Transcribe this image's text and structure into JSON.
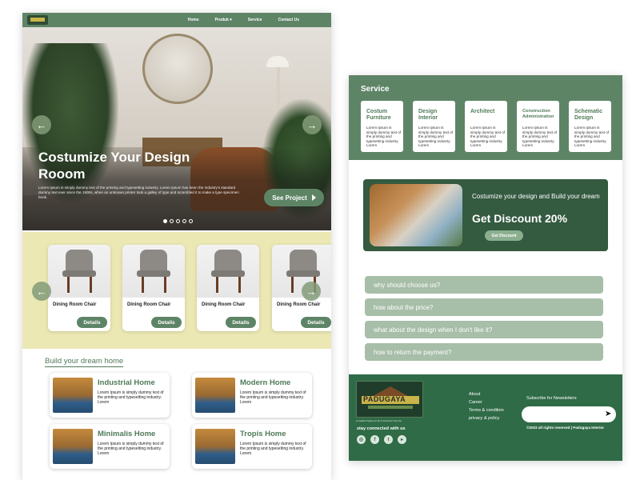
{
  "left_page": {
    "nav": {
      "links": [
        "Home",
        "Produk ▾",
        "Service",
        "Contact Us"
      ]
    },
    "hero": {
      "title": "Costumize Your Design Rooom",
      "description": "Lorem Ipsum is simply dummy text of the printing and typesetting industry. Lorem Ipsum has been the industry's standard dummy text ever since the 1500s, when an unknown printer took a galley of type and scrambled it to make a type specimen book.",
      "cta_label": "See Project",
      "slide_count": 5,
      "active_slide": 1
    },
    "products": {
      "items": [
        {
          "name": "Dining Room Chair",
          "button": "Details"
        },
        {
          "name": "Dining Room Chair",
          "button": "Details"
        },
        {
          "name": "Dining Room Chair",
          "button": "Details"
        },
        {
          "name": "Dining Room Chair",
          "button": "Details"
        }
      ]
    },
    "build": {
      "heading": "Build your dream home",
      "cards": [
        {
          "title": "Industrial Home",
          "text": "Lorem Ipsum is simply dummy text of the printing and typesetting industry. Lorem"
        },
        {
          "title": "Modern Home",
          "text": "Lorem Ipsum is simply dummy text of the printing and typesetting industry. Lorem"
        },
        {
          "title": "Minimalis Home",
          "text": "Lorem Ipsum is simply dummy text of the printing and typesetting industry. Lorem"
        },
        {
          "title": "Tropis Home",
          "text": "Lorem Ipsum is simply dummy text of the printing and typesetting industry. Lorem"
        }
      ]
    }
  },
  "right_page": {
    "service": {
      "title": "Service",
      "cards": [
        {
          "name": "Costum Furniture",
          "text": "Lorem Ipsum is simply dummy text of the printing and typesetting industry. Lorem"
        },
        {
          "name": "Design Interior",
          "text": "Lorem Ipsum is simply dummy text of the printing and typesetting industry. Lorem"
        },
        {
          "name": "Architect",
          "text": "Lorem Ipsum is simply dummy text of the printing and typesetting industry. Lorem"
        },
        {
          "name": "Construction Administration",
          "text": "Lorem Ipsum is simply dummy text of the printing and typesetting industry. Lorem"
        },
        {
          "name": "Schematic Design",
          "text": "Lorem Ipsum is simply dummy text of the printing and typesetting industry. Lorem"
        }
      ]
    },
    "promo": {
      "line1": "Costumize your design and Build your dream",
      "headline": "Get Discount 20%",
      "button": "Get Discount"
    },
    "faq": [
      "why should choose us?",
      "how about the price?",
      "what about the design when I don't like it?",
      "how to return the payment?"
    ],
    "footer": {
      "brand": "PADUGAYA",
      "tagline": "Ini Adalah Tagline Ke Bu Ki Deskripsi Toko Ibu",
      "stay_connected": "stay connected with us",
      "social": [
        "instagram-icon",
        "facebook-icon",
        "twitter-icon",
        "youtube-icon"
      ],
      "links": [
        "About",
        "Career",
        "Terms & condition",
        "privacy & policy"
      ],
      "subscribe_label": "Subscribe for Newsletters",
      "copyright": "©2023 all rights reserved | Padugaya Interior"
    }
  },
  "colors": {
    "primary_green": "#5e8466",
    "dark_green": "#2f6b46",
    "promo_green": "#345a40",
    "product_bg": "#ebe8b4",
    "faq_green": "#a7bea8"
  }
}
